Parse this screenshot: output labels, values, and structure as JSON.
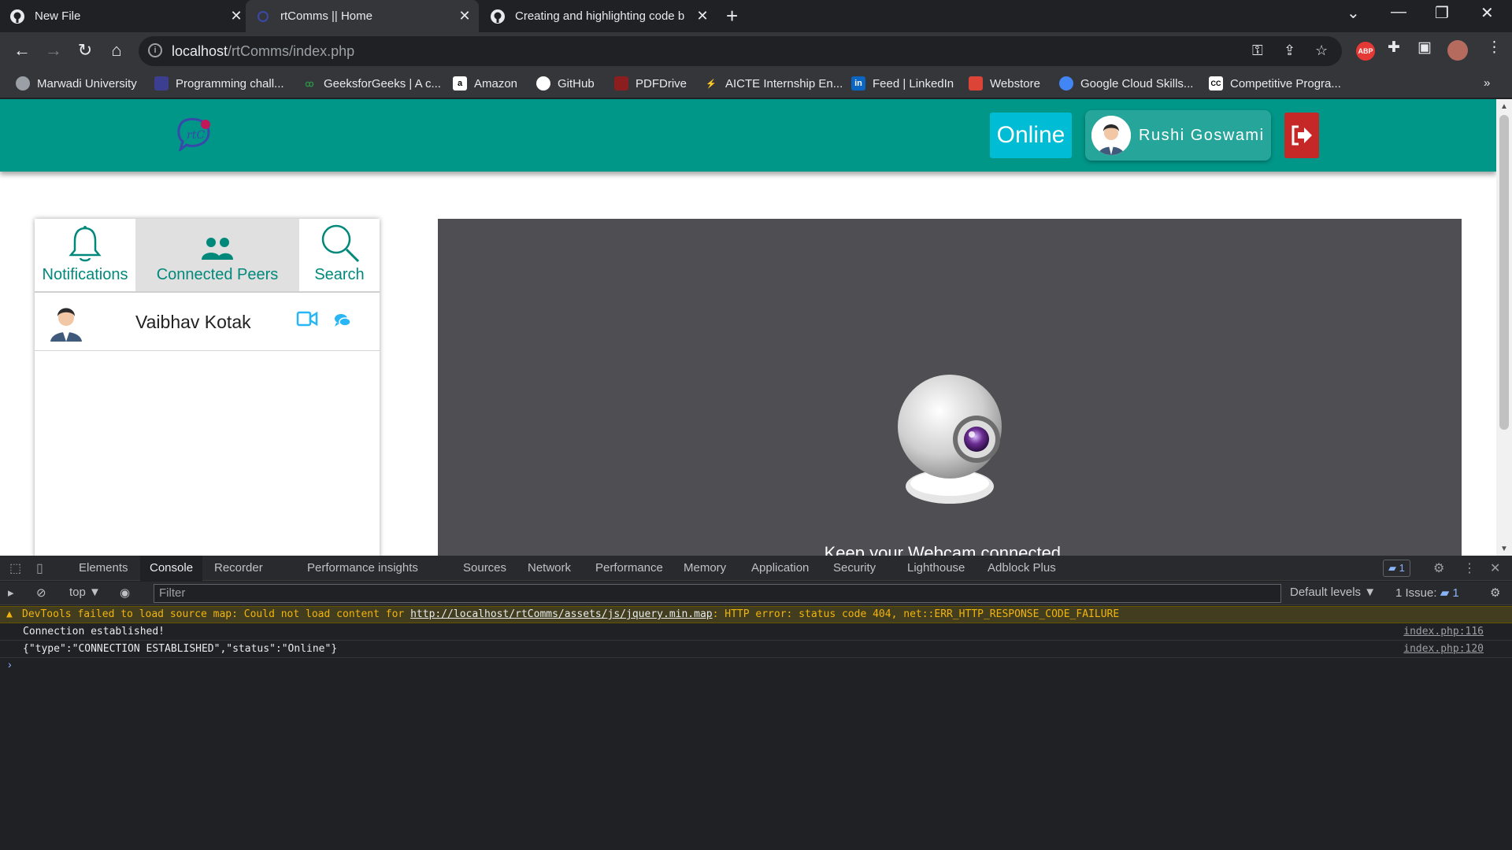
{
  "browser": {
    "tabs": [
      {
        "title": "New File",
        "icon": "github-icon",
        "active": false
      },
      {
        "title": "rtComms || Home",
        "icon": "rtcomms-icon",
        "active": true
      },
      {
        "title": "Creating and highlighting code b",
        "icon": "github-icon",
        "active": false
      }
    ],
    "new_tab": "+",
    "url_host": "localhost",
    "url_path": "/rtComms/index.php",
    "bookmarks": [
      {
        "label": "Marwadi University",
        "icon": "globe-icon",
        "color": "#9aa0a6"
      },
      {
        "label": "Programming chall...",
        "icon": "blank-icon",
        "color": "#3c3f8f"
      },
      {
        "label": "GeeksforGeeks | A c...",
        "icon": "gfg-icon",
        "color": "#2f8d46"
      },
      {
        "label": "Amazon",
        "icon": "amazon-icon",
        "color": "#ffffff"
      },
      {
        "label": "GitHub",
        "icon": "github-icon",
        "color": "#ffffff"
      },
      {
        "label": "PDFDrive",
        "icon": "pdf-icon",
        "color": "#8b1e1e"
      },
      {
        "label": "AICTE Internship En...",
        "icon": "aicte-icon",
        "color": "#f5c400"
      },
      {
        "label": "Feed | LinkedIn",
        "icon": "linkedin-icon",
        "color": "#0a66c2"
      },
      {
        "label": "Webstore",
        "icon": "webstore-icon",
        "color": "#db4437"
      },
      {
        "label": "Google Cloud Skills...",
        "icon": "gcloud-icon",
        "color": "#4285f4"
      },
      {
        "label": "Competitive Progra...",
        "icon": "cc-icon",
        "color": "#ffffff"
      }
    ],
    "bookmarks_more": "»",
    "extension_abp": "ABP"
  },
  "app": {
    "status_label": "Online",
    "user_name": "Rushi Goswami",
    "sidebar_tabs": [
      {
        "label": "Notifications",
        "icon": "bell-icon"
      },
      {
        "label": "Connected Peers",
        "icon": "peers-icon"
      },
      {
        "label": "Search",
        "icon": "search-icon"
      }
    ],
    "peers": [
      {
        "name": "Vaibhav Kotak"
      }
    ],
    "webcam_message": "Keep your Webcam connected...",
    "colors": {
      "header": "#009688",
      "online": "#00bcd4",
      "profile": "#26a69a",
      "logout": "#c62828",
      "accent": "#00897b",
      "video_bg": "#4f4e52"
    }
  },
  "devtools": {
    "tabs": [
      "Elements",
      "Console",
      "Recorder",
      "Performance insights",
      "Sources",
      "Network",
      "Performance",
      "Memory",
      "Application",
      "Security",
      "Lighthouse",
      "Adblock Plus"
    ],
    "active_tab": "Console",
    "issues_badge": "1",
    "context": "top",
    "filter_placeholder": "Filter",
    "levels": "Default levels ▼",
    "issues_label": "1 Issue:",
    "issues_count": "1",
    "warning": {
      "prefix": "DevTools failed to load source map: Could not load content for ",
      "link": "http://localhost/rtComms/assets/js/jquery.min.map",
      "suffix": ": HTTP error: status code 404, net::ERR_HTTP_RESPONSE_CODE_FAILURE"
    },
    "logs": [
      {
        "text": "Connection established!",
        "source": "index.php:116"
      },
      {
        "text": "{\"type\":\"CONNECTION ESTABLISHED\",\"status\":\"Online\"}",
        "source": "index.php:120"
      }
    ],
    "prompt": "›"
  }
}
